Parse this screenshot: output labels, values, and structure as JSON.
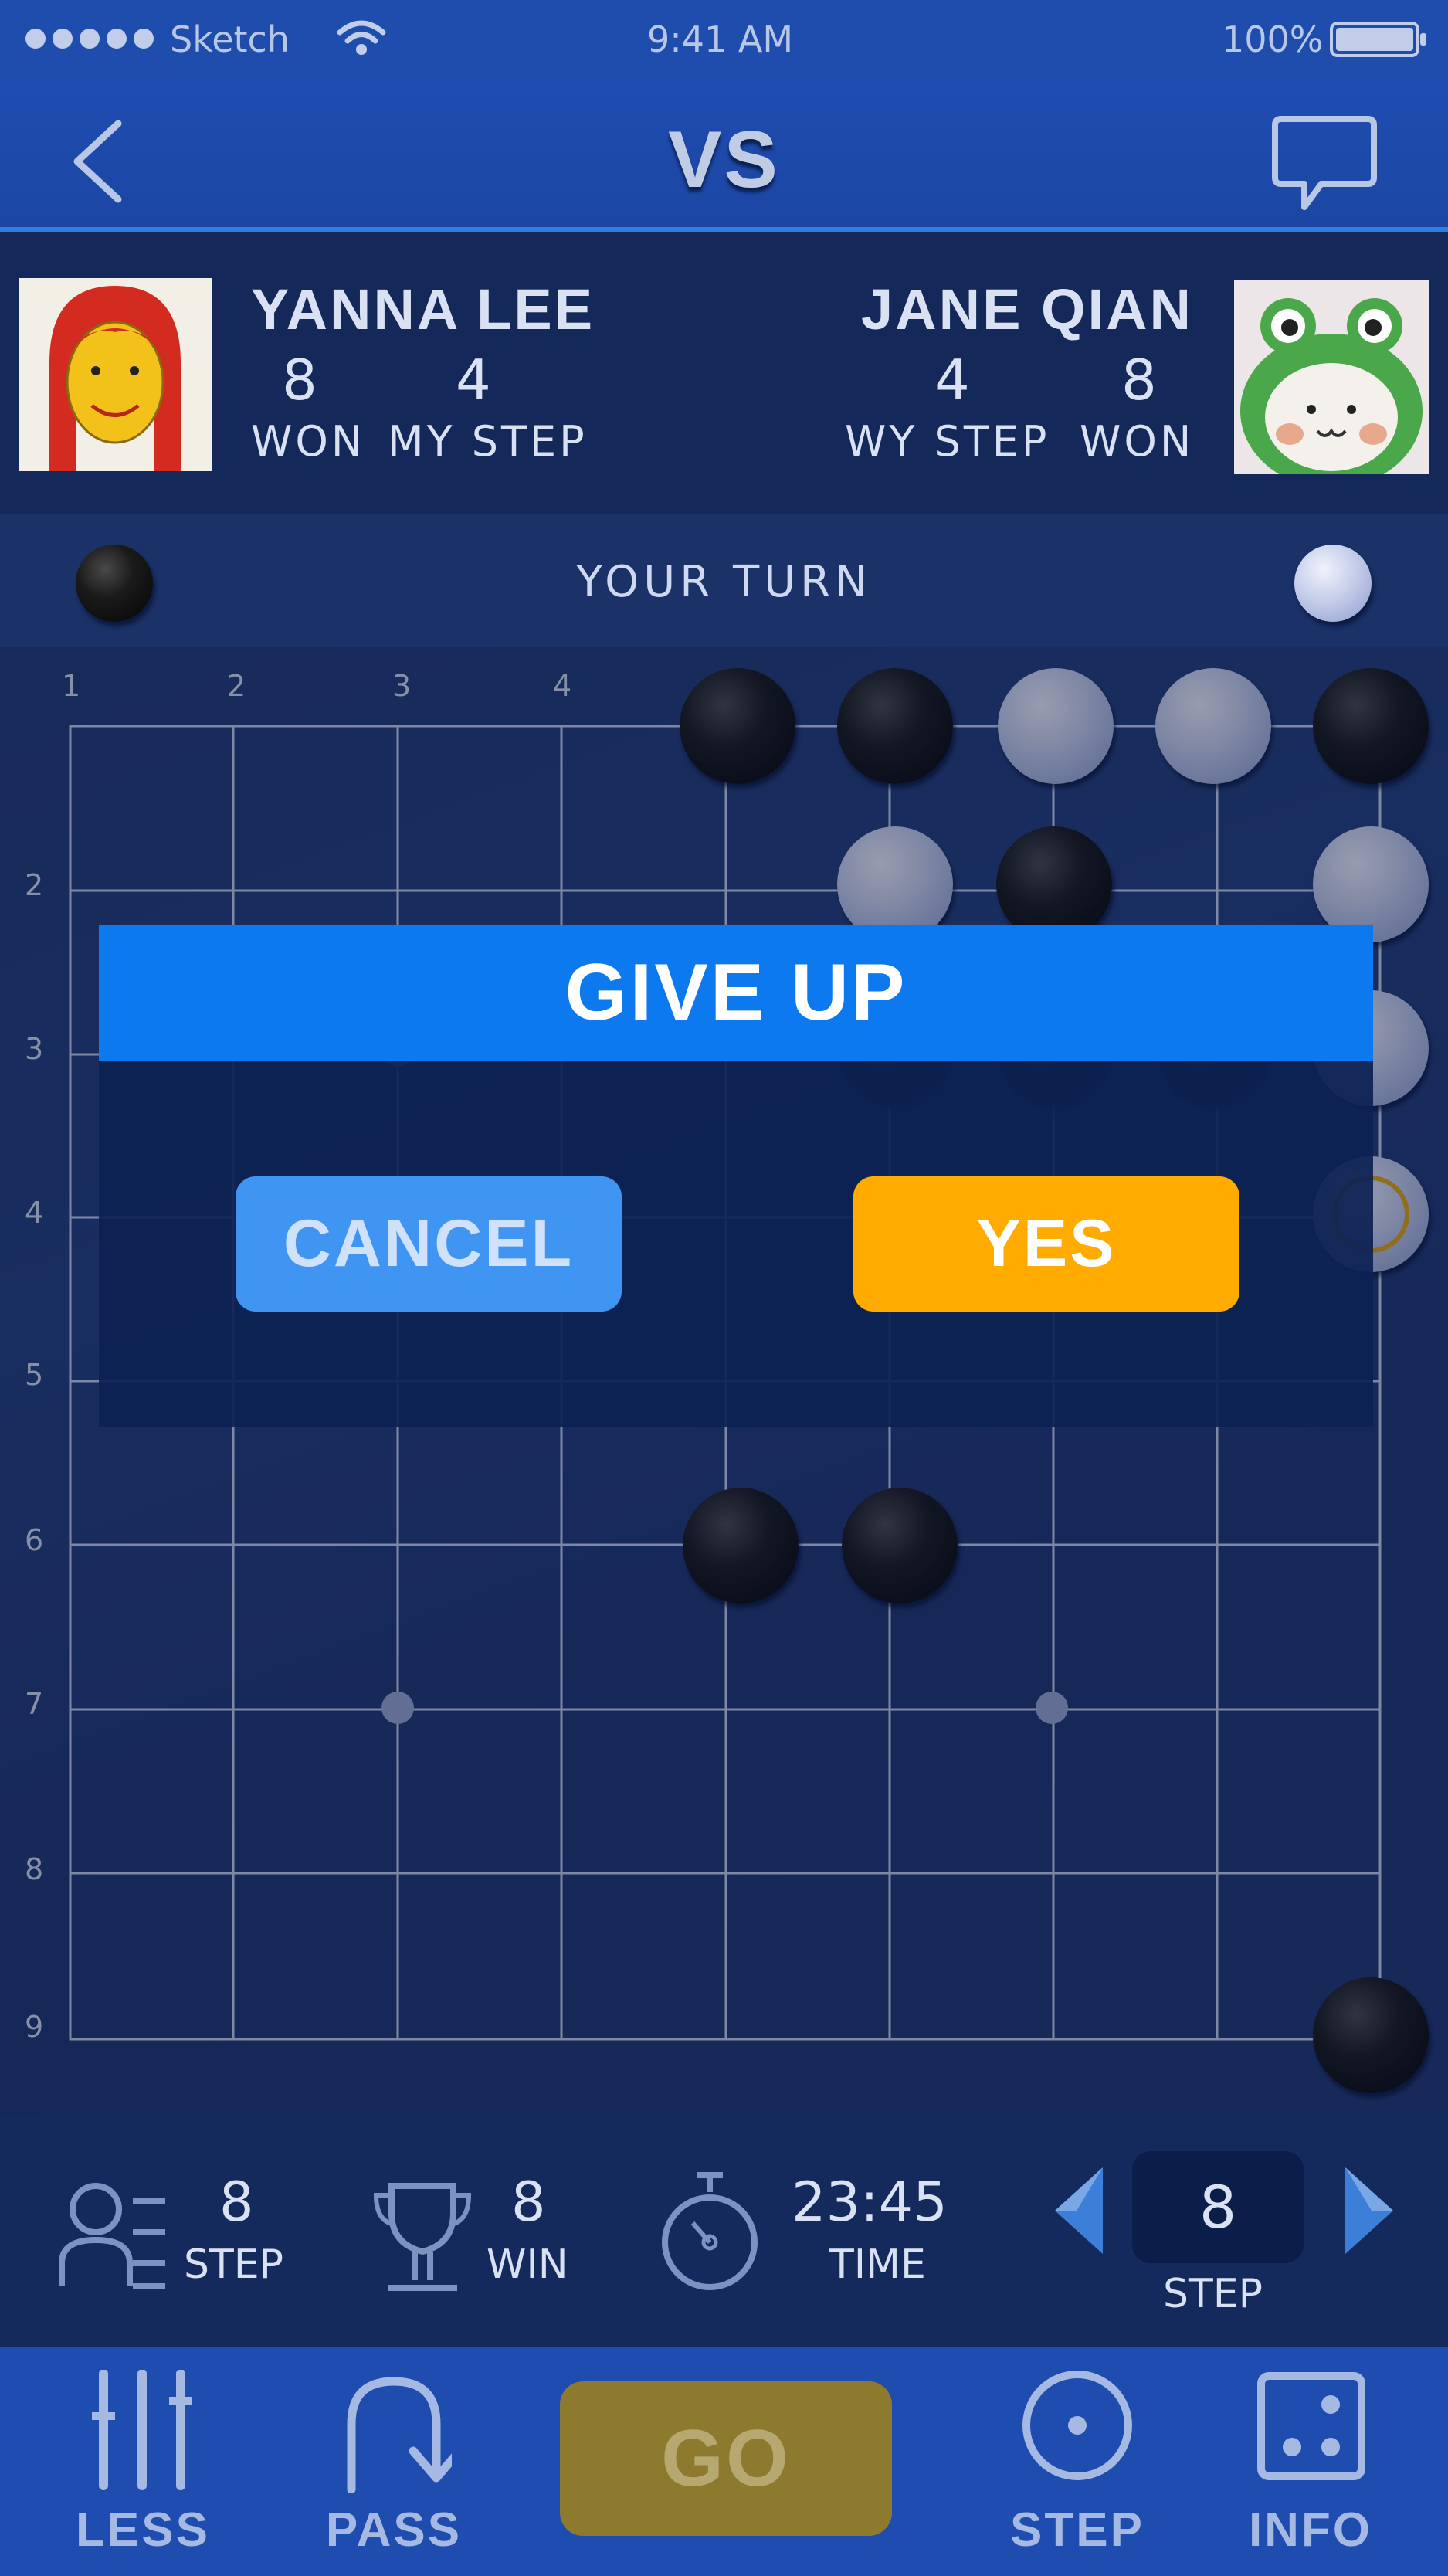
{
  "status_bar": {
    "carrier": "Sketch",
    "time": "9:41 AM",
    "battery": "100%",
    "icons": [
      "signal-dots-icon",
      "wifi-icon",
      "battery-icon"
    ]
  },
  "header": {
    "title": "VS",
    "back_icon": "chevron-left-icon",
    "chat_icon": "chat-bubble-icon"
  },
  "players": {
    "left": {
      "name": "YANNA LEE",
      "won_value": "8",
      "won_label": "WON",
      "step_value": "4",
      "step_label": "MY STEP",
      "avatar": "red-hair-girl-avatar"
    },
    "right": {
      "name": "JANE QIAN",
      "step_value": "4",
      "step_label": "WY STEP",
      "won_value": "8",
      "won_label": "WON",
      "avatar": "frog-hood-avatar"
    }
  },
  "turn": {
    "text": "YOUR TURN"
  },
  "board": {
    "top_labels": [
      "1",
      "2",
      "3",
      "4"
    ],
    "side_labels": [
      "2",
      "3",
      "4",
      "5",
      "6",
      "7",
      "8",
      "9"
    ]
  },
  "dialog": {
    "title": "GIVE UP",
    "cancel_label": "CANCEL",
    "yes_label": "YES"
  },
  "stats": {
    "step": {
      "value": "8",
      "label": "STEP",
      "icon": "profile-list-icon"
    },
    "win": {
      "value": "8",
      "label": "WIN",
      "icon": "trophy-icon"
    },
    "time": {
      "value": "23:45",
      "label": "TIME",
      "icon": "stopwatch-icon"
    },
    "stepper": {
      "value": "8",
      "label": "STEP"
    }
  },
  "tabs": [
    {
      "label": "LESS",
      "icon": "sliders-icon"
    },
    {
      "label": "PASS",
      "icon": "pass-arrow-icon"
    },
    {
      "label": "GO",
      "icon": ""
    },
    {
      "label": "STEP",
      "icon": "step-circle-icon"
    },
    {
      "label": "INFO",
      "icon": "dice-icon"
    }
  ],
  "colors": {
    "accent_blue": "#0d79ef",
    "yes_orange": "#ffab00",
    "cancel_blue": "#3f95f1",
    "go_gold": "#8e7a2f"
  }
}
